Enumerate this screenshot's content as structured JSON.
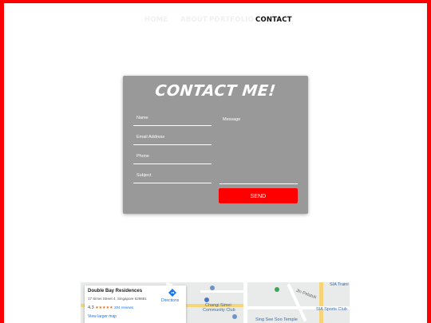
{
  "nav": {
    "items": [
      {
        "label": "HOME",
        "active": false
      },
      {
        "label": "ABOUT",
        "active": false
      },
      {
        "label": "PORTFOLIO",
        "active": false
      },
      {
        "label": "CONTACT",
        "active": true
      }
    ]
  },
  "contact": {
    "title": "CONTACT ME!",
    "fields": {
      "name_placeholder": "Name",
      "email_placeholder": "Email Address",
      "phone_placeholder": "Phone",
      "subject_placeholder": "Subject",
      "message_placeholder": "Message"
    },
    "send_label": "SEND"
  },
  "map": {
    "place_name": "Double Bay Residences",
    "address": "17 Simei Street 4, Singapore 529881",
    "rating": "4.3",
    "stars": "★★★★★",
    "reviews": "204 reviews",
    "directions_label": "Directions",
    "larger_map_label": "View larger map",
    "poi_changi": "Changi Simei",
    "poi_changi2": "Community Club",
    "poi_sia_training": "SIA Traini",
    "poi_sia_sports": "SIA Sports Club",
    "poi_jln": "Jln Pelatuk",
    "poi_sing_see": "Sing See Soo Temple"
  },
  "colors": {
    "accent": "#ff0000",
    "card": "#999999",
    "frame": "#ff0000"
  }
}
